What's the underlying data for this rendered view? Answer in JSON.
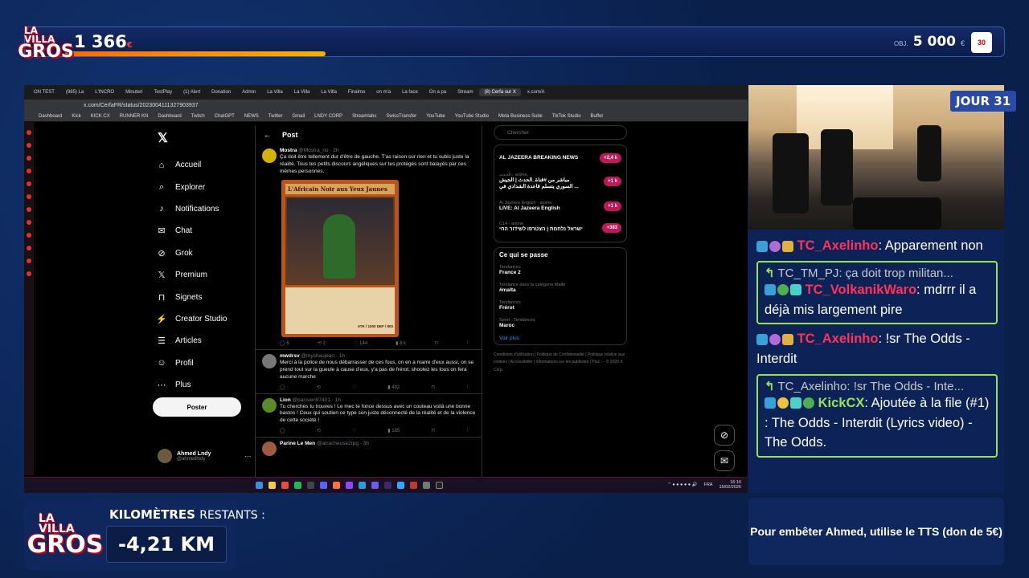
{
  "overlay": {
    "logo": {
      "line1": "LA VILLA",
      "line2": "GROS"
    },
    "top_count": "1 366",
    "top_count_currency": "€",
    "donation_progress": 0.27,
    "goal_label": "OBJ.",
    "goal_amount": "5 000",
    "goal_currency": "€",
    "day_badge": "JOUR 31",
    "km_label": "KILOMÈTRES",
    "km_label2": "RESTANTS :",
    "km_value": "-4,21 KM",
    "tts_text": "Pour embêter Ahmed, utilise le TTS (don de 5€)"
  },
  "browser": {
    "tabs": [
      "ON TEST",
      "(985) La",
      "L'INCRO",
      "Minuteri",
      "TestPlay",
      "(1) Alert",
      "Donation",
      "Admin",
      "La Villa",
      "La Villa",
      "La Villa",
      "Finalmo",
      "on m'a",
      "La face",
      "On a pa",
      "Stream",
      "(8) Cerfa sur X",
      "x.com/A"
    ],
    "active_tab": "(8) Cerfa sur X",
    "url": "x.com/CerfaFR/status/2023004111327903937",
    "bookmarks": [
      "Dashboard",
      "Kick",
      "KICK CX",
      "RUNNER KN",
      "Dashboard",
      "Twitch",
      "ChatGPT",
      "NEWS",
      "Twitter",
      "Gmail",
      "LNDY CORP",
      "Streamlabs",
      "SwissTransfer",
      "YouTube",
      "YouTube Studio",
      "Meta Business Suite",
      "TikTok Studio",
      "Buffer"
    ]
  },
  "x": {
    "nav": [
      {
        "label": "Accueil",
        "icon": "home-icon",
        "glyph": "⌂"
      },
      {
        "label": "Explorer",
        "icon": "search-icon",
        "glyph": "⌕"
      },
      {
        "label": "Notifications",
        "icon": "bell-icon",
        "glyph": "♪"
      },
      {
        "label": "Chat",
        "icon": "chat-icon",
        "glyph": "✉"
      },
      {
        "label": "Grok",
        "icon": "grok-icon",
        "glyph": "⊘"
      },
      {
        "label": "Premium",
        "icon": "x-premium-icon",
        "glyph": "𝕏"
      },
      {
        "label": "Signets",
        "icon": "bookmark-icon",
        "glyph": "⊓"
      },
      {
        "label": "Creator Studio",
        "icon": "creator-icon",
        "glyph": "⚡"
      },
      {
        "label": "Articles",
        "icon": "articles-icon",
        "glyph": "☰"
      },
      {
        "label": "Profil",
        "icon": "profile-icon",
        "glyph": "☺"
      },
      {
        "label": "Plus",
        "icon": "more-icon",
        "glyph": "⋯"
      }
    ],
    "post_button": "Poster",
    "profile": {
      "name": "Ahmed Lndy",
      "handle": "@ahmedlndy"
    },
    "timeline_title": "Post",
    "tweets": [
      {
        "name": "Mostra",
        "handle": "@Mostra_no · 2h",
        "text": "Ça doit être tellement dur d'être de gauche. T'as raison sur rien et tu subis juste la réalité. Tous tes petits discours angéliques sur tes protégés sont balayés par ces mêmes personnes.",
        "replies": "6",
        "retweets": "2",
        "likes": "144",
        "views": "8 k"
      },
      {
        "name": "mwdrsv",
        "handle": "@myshaujean · 1h",
        "text": "Merci à la police de nous débarrasser de ces fous, on en a marre d'eux aussi, on se prend tout sur la gueule à cause d'eux, y'a pas de frérot, shootez les tous on fera aucune marche",
        "replies": "",
        "retweets": "",
        "likes": "",
        "views": "492"
      },
      {
        "name": "Lion",
        "handle": "@parisien97401 · 1h",
        "text": "Tu cherches tu trouves ! Le mec te fonce dessus avec un couteau voilà une bonne bastos ! Ceux qui soutien ce type son juste déconnecté de la réalité et de la violence de cette société !",
        "replies": "",
        "retweets": "",
        "likes": "",
        "views": "185"
      },
      {
        "name": "Parine Le Men",
        "handle": "@arracheuse2rpg · 3h",
        "text": "",
        "replies": "",
        "retweets": "",
        "likes": "",
        "views": ""
      }
    ],
    "card": {
      "title": "L'Africain Noir aux Yeux Jaunes",
      "atk": "ATK / 1000  DEF / 800"
    },
    "search_placeholder": "Chercher",
    "live": [
      {
        "title": "AL JAZEERA BREAKING NEWS",
        "sub": "",
        "count": "+2,4 k"
      },
      {
        "title": "مباشر من #قناة_الحدث | الجيش السوري يتسلم قاعدة الشدادي في ...",
        "sub": "الحدث · anime.",
        "count": "+1 k"
      },
      {
        "title": "LIVE: Al Jazeera English",
        "sub": "Al Jazeera English · anime.",
        "count": "+1 k"
      },
      {
        "title": "ישראל נלחמת | הצטרפו לשידור החי",
        "sub": "C14 · anime.",
        "count": "+383"
      }
    ],
    "whats_happening": "Ce qui se passe",
    "trends": [
      {
        "cat": "Tendances",
        "val": "France 2"
      },
      {
        "cat": "Tendance dans la catégorie Malte",
        "val": "#malta"
      },
      {
        "cat": "Tendances",
        "val": "Frérot"
      },
      {
        "cat": "Sport · Tendances",
        "val": "Maroc"
      }
    ],
    "show_more": "Voir plus",
    "footer": "Conditions d'utilisation | Politique de Confidentialité | Politique relative aux cookies | Accessibilité | Informations sur les publicités | Plus ··· © 2026 X Corp."
  },
  "taskbar": {
    "lang": "FRA",
    "time": "16:16",
    "date": "15/02/2026"
  },
  "chat": {
    "m1_user": "TC_Axelinho",
    "m1_text": "Apparement non",
    "r1_user": "TC_TM_PJ:",
    "r1_text": "ça doit trop militan...",
    "m2_user": "TC_VolkanikWaro",
    "m2_text": "mdrrr il a déjà mis largement pire",
    "m3_user": "TC_Axelinho",
    "m3_text": "!sr The Odds - Interdit",
    "r2_user": "TC_Axelinho:",
    "r2_text": "!sr The Odds - Inte...",
    "m4_user": "KickCX",
    "m4_text": "Ajoutée à la file (#1) : The Odds - Interdit (Lyrics video) - The Odds."
  },
  "colors": {
    "accent_red": "#ff3358",
    "chat_green": "#9be05a",
    "panel_blue": "#10275e"
  }
}
